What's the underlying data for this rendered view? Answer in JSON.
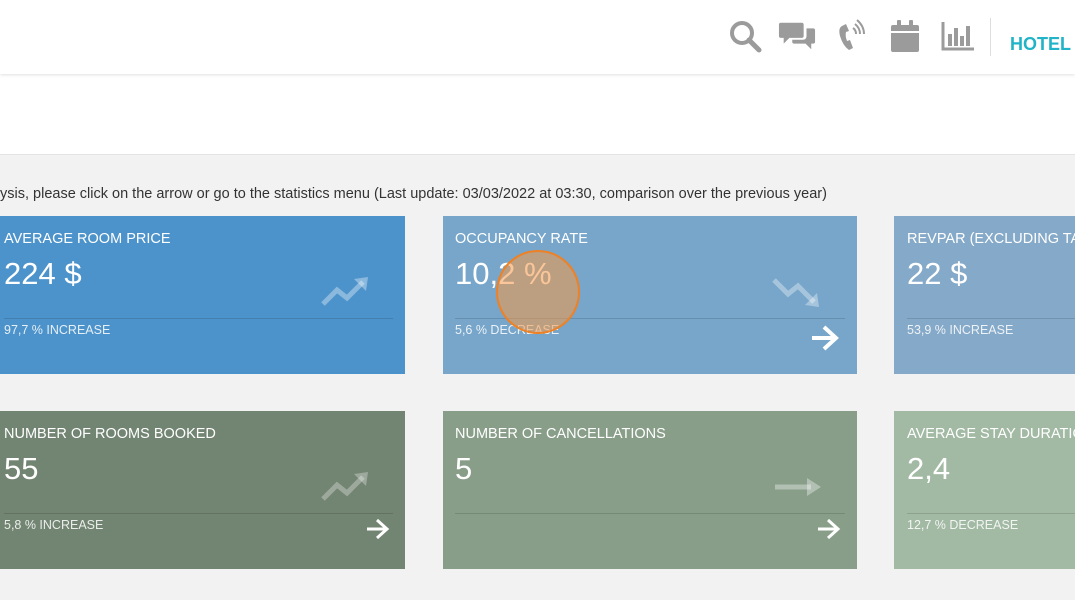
{
  "header": {
    "icons": [
      "search-icon",
      "comments-icon",
      "phone-icon",
      "calendar-icon",
      "bar-chart-icon"
    ],
    "hotel_label": "HOTEL S"
  },
  "info_text": "ysis, please click on the arrow or go to the statistics menu (Last update: 03/03/2022 at 03:30, comparison over the previous year)",
  "cards": [
    {
      "title": "AVERAGE ROOM PRICE",
      "value": "224 $",
      "change": "97,7 % INCREASE",
      "trend": "up",
      "color": "#4d93cb"
    },
    {
      "title": "OCCUPANCY RATE",
      "value": "10,2 %",
      "change": "5,6 % DECREASE",
      "trend": "down",
      "color": "#77a6ca"
    },
    {
      "title": "REVPAR (EXCLUDING TAX",
      "value": "22 $",
      "change": "53,9 % INCREASE",
      "trend": "up",
      "color": "#85a9c8"
    },
    {
      "title": "NUMBER OF ROOMS BOOKED",
      "value": "55",
      "change": "5,8 % INCREASE",
      "trend": "up",
      "color": "#728472"
    },
    {
      "title": "NUMBER OF CANCELLATIONS",
      "value": "5",
      "change": "",
      "trend": "flat",
      "color": "#889e89"
    },
    {
      "title": "AVERAGE STAY DURATIO",
      "value": "2,4",
      "change": "12,7 % DECREASE",
      "trend": "down",
      "color": "#a2b9a4"
    }
  ],
  "colors": {
    "accent": "#21b3c7",
    "icon_gray": "#9b9b9b",
    "click_indicator": "#f08020"
  }
}
